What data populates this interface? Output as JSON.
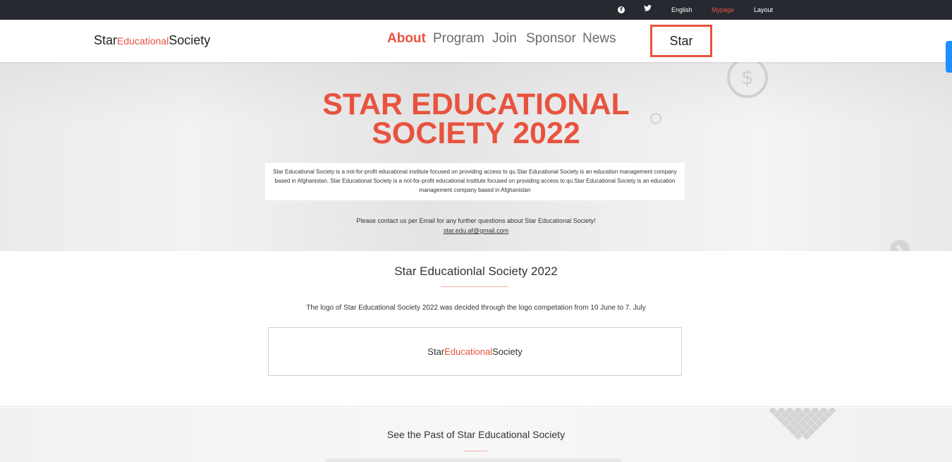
{
  "topbar": {
    "social": [
      "facebook-icon",
      "twitter-icon"
    ],
    "english": "English",
    "mypage": "Mypage",
    "layout": "Layout"
  },
  "header": {
    "logo": {
      "left": "Star",
      "mid": "Educational",
      "right": "Society"
    },
    "nav": [
      "About",
      "Program",
      "Join",
      "Sponsor",
      "News"
    ],
    "active_nav": "About",
    "star_button": "Star"
  },
  "hero": {
    "title_line1": "STAR EDUCATIONAL",
    "title_line2": "SOCIETY 2022",
    "description": "Star Educational Society is a not-for-profit educational institute focused on providing access to qu.Star Educational Society is an education management company based in Afghanistan. Star Educational Society is a not-for-profit educational institute focused on providing access to qu.Star Educational Society is an education management company based in Afghanistan",
    "contact": "Please contact us per Email for any further questions about Star Educational Society!",
    "email": "star.edu.af@gmail.com"
  },
  "section1": {
    "title": "Star Educationlal Society 2022",
    "text": "The logo of Star Educational Society 2022 was decided through the logo competation from 10 June to 7. July",
    "logo_box": {
      "left": "Star",
      "mid": "Educational",
      "right": "Society"
    }
  },
  "section2": {
    "title": "See the Past of Star Educational Society"
  },
  "colors": {
    "accent": "#e8533f",
    "topbar": "#262930",
    "side_tab": "#1e90ff"
  }
}
